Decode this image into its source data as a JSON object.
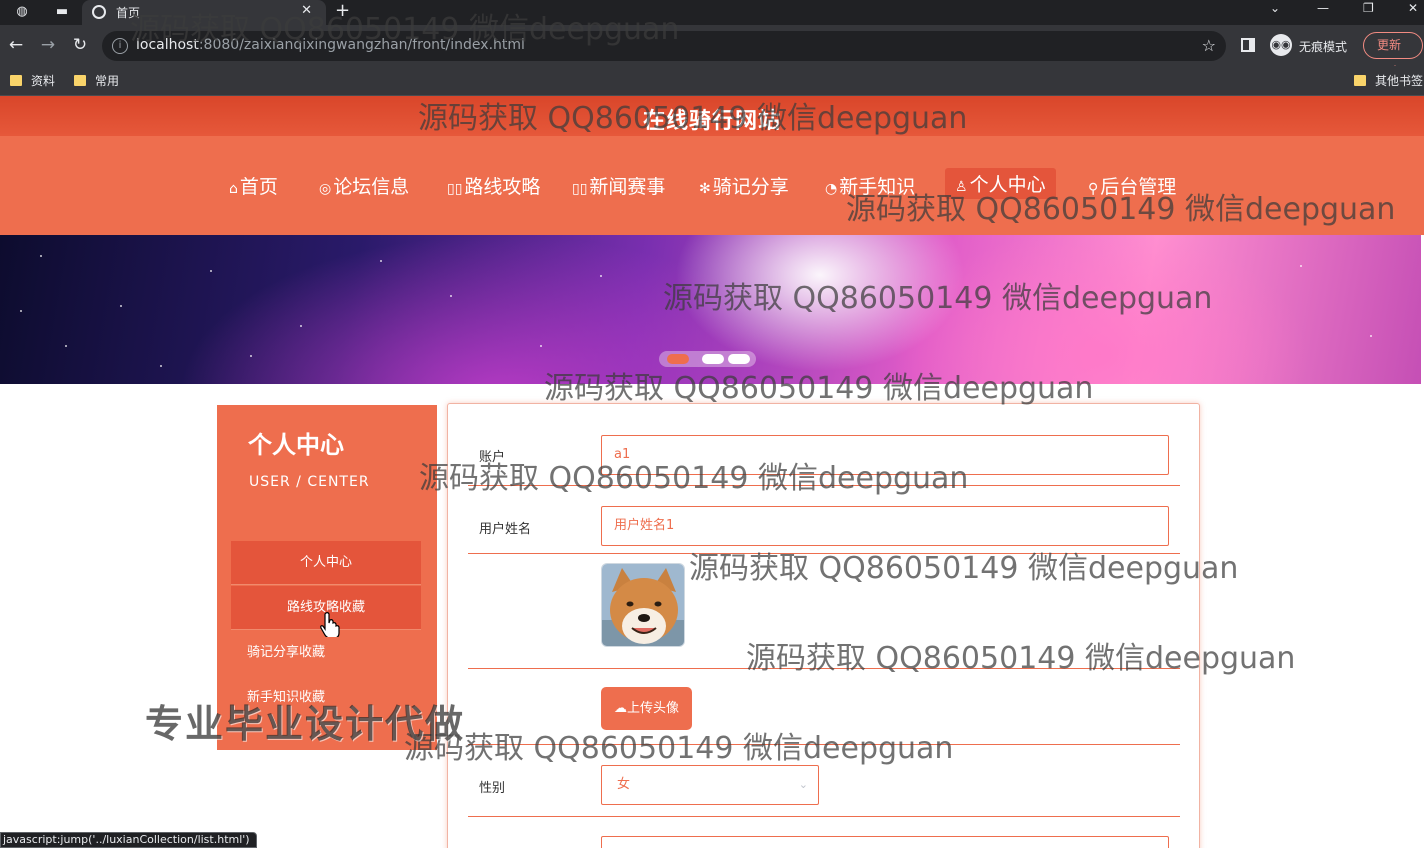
{
  "browser": {
    "tab_title": "首页",
    "url_host": "localhost",
    "url_path": ":8080/zaixianqixingwangzhan/front/index.html",
    "incognito_label": "无痕模式",
    "update_label": "更新",
    "bookmarks": [
      "资料",
      "常用"
    ],
    "other_bookmarks": "其他书签",
    "status_url": "javascript:jump('../luxianCollection/list.html')"
  },
  "site": {
    "title": "在线骑行网站",
    "menu": [
      {
        "icon": "⌂",
        "label": "首页"
      },
      {
        "icon": "◎",
        "label": "论坛信息"
      },
      {
        "icon": "▯▯",
        "label": "路线攻略"
      },
      {
        "icon": "▯▯",
        "label": "新闻赛事"
      },
      {
        "icon": "✻",
        "label": "骑记分享"
      },
      {
        "icon": "◔",
        "label": "新手知识"
      },
      {
        "icon": "♙",
        "label": "个人中心"
      },
      {
        "icon": "⚲",
        "label": "后台管理"
      }
    ],
    "active_menu": "个人中心"
  },
  "sidebar": {
    "title": "个人中心",
    "subtitle": "USER / CENTER",
    "items": [
      "个人中心",
      "路线攻略收藏",
      "骑记分享收藏",
      "新手知识收藏"
    ]
  },
  "form": {
    "account_label": "账户",
    "account_value": "a1",
    "name_label": "用户姓名",
    "name_value": "用户姓名1",
    "upload_label": "上传头像",
    "gender_label": "性别",
    "gender_value": "女"
  },
  "overlays": {
    "watermark": "源码获取 QQ86050149 微信deepguan",
    "promo": "专业毕业设计代做"
  },
  "colors": {
    "primary": "#ee6e4e",
    "primary_dark": "#e4553b",
    "chrome_dark": "#202124"
  }
}
